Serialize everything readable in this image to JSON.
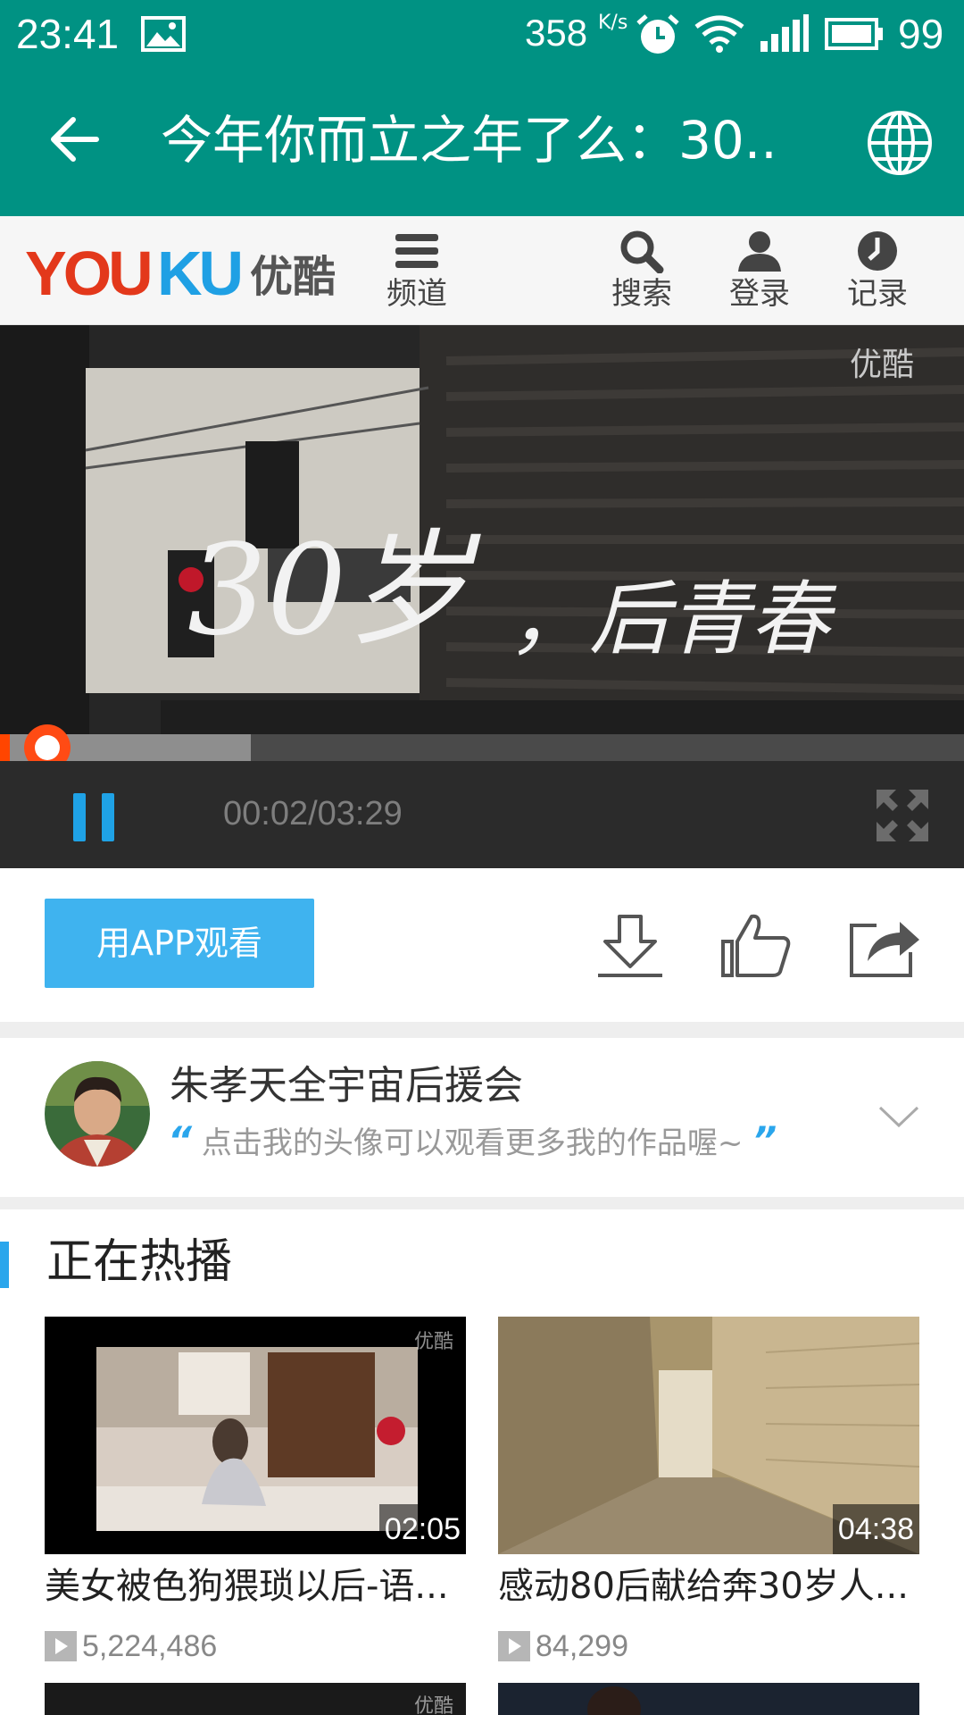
{
  "status_bar": {
    "time": "23:41",
    "speed": "358",
    "speed_unit": "K/s",
    "battery": "99"
  },
  "app_bar": {
    "title": "今年你而立之年了么：30.."
  },
  "youku": {
    "logo_text": "YOUKU 优酷",
    "nav": [
      {
        "label": "频道",
        "icon": "menu-icon"
      },
      {
        "label": "搜索",
        "icon": "search-icon"
      },
      {
        "label": "登录",
        "icon": "user-icon"
      },
      {
        "label": "记录",
        "icon": "history-icon"
      }
    ]
  },
  "player": {
    "watermark": "优酷",
    "overlay_text": "30岁，后青春",
    "time_display": "00:02/03:29",
    "progress_played": 0.01,
    "progress_buffered": 0.26
  },
  "actions": {
    "app_button": "用APP观看",
    "icons": [
      "download-icon",
      "like-icon",
      "share-icon"
    ]
  },
  "uploader": {
    "name": "朱孝天全宇宙后援会",
    "slogan": "点击我的头像可以观看更多我的作品喔~",
    "quote_open": "“",
    "quote_close": "”"
  },
  "hot": {
    "title": "正在热播",
    "items": [
      {
        "title": "美女被色狗猥琐以后-语...",
        "duration": "02:05",
        "views": "5,224,486",
        "watermark": "优酷"
      },
      {
        "title": "感动80后献给奔30岁人...",
        "duration": "04:38",
        "views": "84,299",
        "watermark": ""
      }
    ],
    "third_row_watermark": "优酷"
  },
  "colors": {
    "header": "#009283",
    "accent_blue": "#3fb3ef",
    "progress": "#ff4500"
  }
}
